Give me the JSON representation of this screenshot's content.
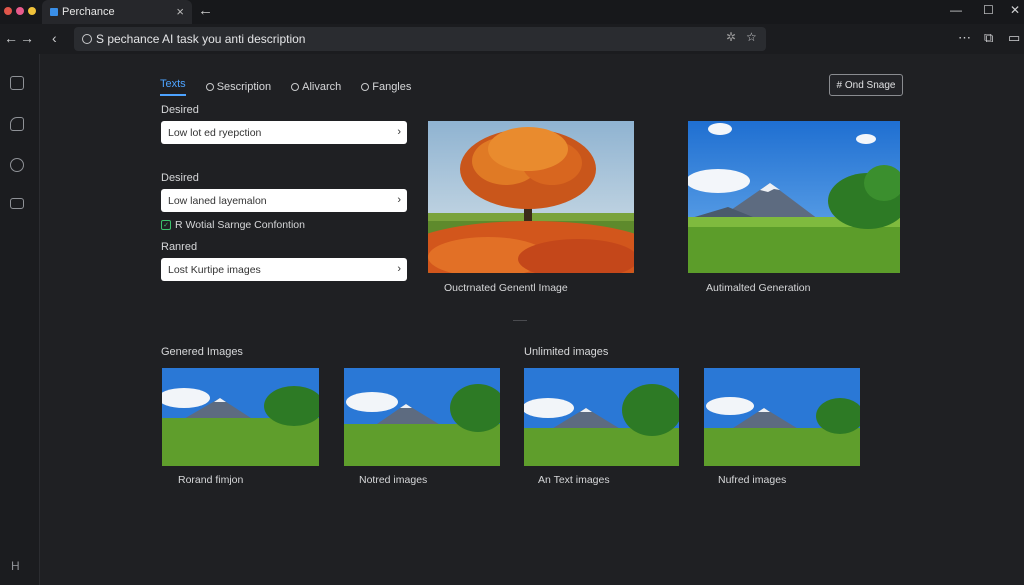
{
  "browser": {
    "tab_title": "Perchance",
    "close_glyph": "×",
    "new_tab_glyph": "←",
    "address": "S pechance AI task you anti description",
    "window_controls": [
      "—",
      "☐",
      "✕"
    ]
  },
  "tabs": [
    {
      "label": "Texts",
      "active": true,
      "icon": ""
    },
    {
      "label": "Sescription",
      "active": false,
      "icon": "tag-icon"
    },
    {
      "label": "Alivarch",
      "active": false,
      "icon": "info-icon"
    },
    {
      "label": "Fangles",
      "active": false,
      "icon": "gear-icon"
    }
  ],
  "stage_button": "# Ond Snage",
  "form": {
    "label1": "Desired",
    "field1": "Low lot ed ryepction",
    "label2": "Desired",
    "field2": "Low laned layemalon",
    "checkbox": "R Wotial Sarnge Confontion",
    "label3": "Ranred",
    "field3": "Lost Kurtipe images",
    "arrow": "›"
  },
  "hero": {
    "left_caption": "Ouctrnated Genentl Image",
    "right_caption": "Autimalted Generation"
  },
  "sections": {
    "generated": "Genered Images",
    "unlimited": "Unlimited images"
  },
  "thumbs": [
    {
      "caption": "Rorand fimjon"
    },
    {
      "caption": "Notred images"
    },
    {
      "caption": "An Text images"
    },
    {
      "caption": "Nufred images"
    }
  ],
  "sidebar_footer": "H",
  "colors": {
    "accent": "#4da3ff",
    "check": "#3cc26c",
    "bg": "#1f2023"
  }
}
